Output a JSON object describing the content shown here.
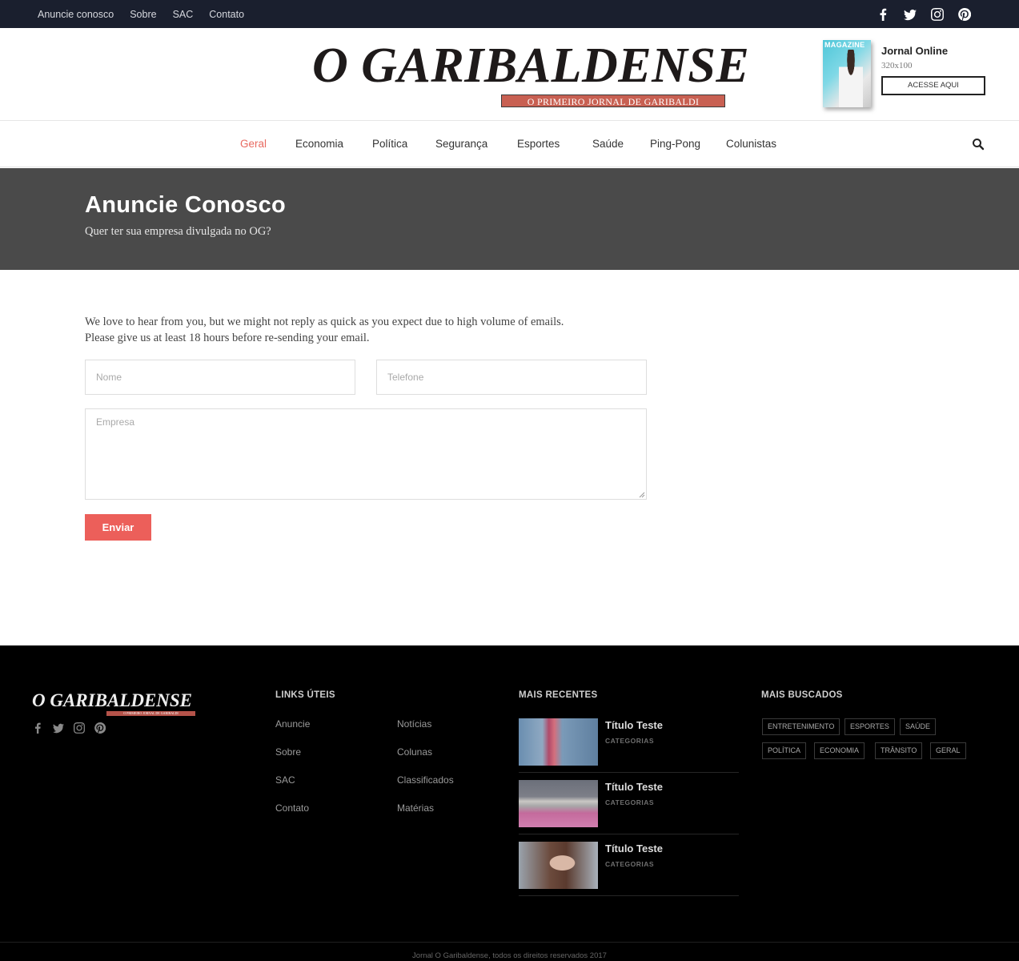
{
  "topbar": {
    "links": [
      "Anuncie conosco",
      "Sobre",
      "SAC",
      "Contato"
    ],
    "social_icons": [
      "facebook-icon",
      "twitter-icon",
      "instagram-icon",
      "pinterest-icon"
    ]
  },
  "header": {
    "logo_name": "O GARIBALDENSE",
    "logo_tagline": "O PRIMEIRO JORNAL DE GARIBALDI",
    "magazine_label": "MAGAZINE",
    "promo_title": "Jornal Online",
    "promo_size": "320x100",
    "promo_button": "ACESSE AQUI"
  },
  "nav": {
    "items": [
      "Geral",
      "Economia",
      "Política",
      "Segurança",
      "Esportes",
      "Saúde",
      "Ping-Pong",
      "Colunistas"
    ],
    "active": "Geral",
    "search_icon": "search-icon"
  },
  "hero": {
    "title": "Anuncie Conosco",
    "subtitle": "Quer ter sua empresa divulgada no OG?"
  },
  "form": {
    "intro_line1": "We love to hear from you, but we might not reply as quick as you expect due to high volume of emails.",
    "intro_line2": "Please give us at least 18 hours before re-sending your email.",
    "nome_placeholder": "Nome",
    "telefone_placeholder": "Telefone",
    "empresa_placeholder": "Empresa",
    "submit": "Enviar"
  },
  "footer": {
    "logo_name": "O GARIBALDENSE",
    "logo_tagline": "O PRIMEIRO JORNAL DE GARIBALDI",
    "links_heading": "LINKS ÚTEIS",
    "links_col1": [
      "Anuncie",
      "Sobre",
      "SAC",
      "Contato"
    ],
    "links_col2": [
      "Notícias",
      "Colunas",
      "Classificados",
      "Matérias"
    ],
    "recent_heading": "MAIS RECENTES",
    "recent": [
      {
        "title": "Título Teste",
        "category": "CATEGORIAS"
      },
      {
        "title": "Título Teste",
        "category": "CATEGORIAS"
      },
      {
        "title": "Título Teste",
        "category": "CATEGORIAS"
      }
    ],
    "tags_heading": "MAIS BUSCADOS",
    "tags": [
      "ENTRETENIMENTO",
      "ESPORTES",
      "SAÚDE",
      "POLÍTICA",
      "ECONOMIA",
      "TRÂNSITO",
      "GERAL"
    ],
    "copyright": "Jornal O Garibaldense, todos os direitos reservados 2017"
  },
  "colors": {
    "topbar_bg": "#1a1f2e",
    "accent": "#ec5f5a",
    "nav_active": "#e86a60",
    "hero_bg": "#4a4a4a",
    "footer_bg": "#000000",
    "logo_tag_bg": "#c86052"
  }
}
